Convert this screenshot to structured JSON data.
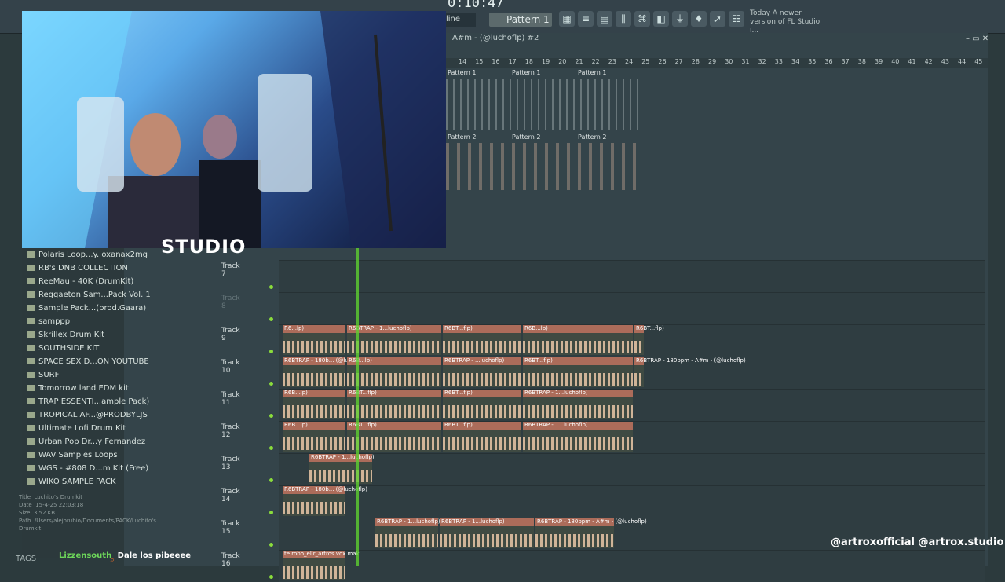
{
  "toolbar": {
    "time": "0:10:47",
    "mode": "line",
    "pattern": "Pattern 1",
    "news_label": "Today",
    "news_text": "A newer version of FL Studio i..."
  },
  "playlist": {
    "title": "A#m - (@luchoflp) #2",
    "ruler_numbers": [
      "14",
      "15",
      "16",
      "17",
      "18",
      "19",
      "20",
      "21",
      "22",
      "23",
      "24",
      "25",
      "26",
      "27",
      "28",
      "29",
      "30",
      "31",
      "32",
      "33",
      "34",
      "35",
      "36",
      "37",
      "38",
      "39",
      "40",
      "41",
      "42",
      "43",
      "44",
      "45"
    ],
    "pattern_labels": [
      "Pattern 1",
      "Pattern 1",
      "Pattern 1",
      "Pattern 2",
      "Pattern 2",
      "Pattern 2"
    ],
    "tracks": [
      {
        "label": "Track 7"
      },
      {
        "label": "Track 8"
      },
      {
        "label": "Track 9",
        "clips": [
          "R6...lp)",
          "R6BTRAP - 1...luchoflp)",
          "R6BT...flp)",
          "R6B...lp)",
          "R6BT...flp)"
        ]
      },
      {
        "label": "Track 10",
        "clips": [
          "R6BTRAP - 180b... (@luchoflp)",
          "R6B...lp)",
          "R6BTRAP - ...luchoflp)",
          "R6BT...flp)",
          "R6BTRAP - 180bpm - A#m - (@luchoflp)"
        ]
      },
      {
        "label": "Track 11",
        "clips": [
          "R6B...lp)",
          "R6BT...flp)",
          "R6BT...flp)",
          "R6BTRAP - 1...luchoflp)"
        ]
      },
      {
        "label": "Track 12",
        "clips": [
          "R6B...lp)",
          "R6BT...flp)",
          "R6BT...flp)",
          "R6BTRAP - 1...luchoflp)"
        ]
      },
      {
        "label": "Track 13",
        "clips": [
          "R6BTRAP - 1...luchoflp)"
        ]
      },
      {
        "label": "Track 14",
        "clips": [
          "R6BTRAP - 180b... (@luchoflp)"
        ]
      },
      {
        "label": "Track 15",
        "clips": [
          "R6BTRAP - 1...luchoflp)",
          "R6BTRAP - 1...luchoflp)",
          "R6BTRAP - 180bpm - A#m - (@luchoflp)"
        ]
      },
      {
        "label": "Track 16",
        "clips": [
          "te robo_ellr_artros vox mak"
        ]
      }
    ]
  },
  "browser": {
    "items": [
      "Polaris Loop...y. oxanax2mg",
      "RB's DNB COLLECTION",
      "ReeMau - 40K (DrumKit)",
      "Reggaeton Sam...Pack Vol. 1",
      "Sample Pack...(prod.Gaara)",
      "samppp",
      "Skrillex Drum Kit",
      "SOUTHSIDE KIT",
      "SPACE SEX D...ON YOUTUBE",
      "SURF",
      "Tomorrow land EDM kit",
      "TRAP ESSENTI...ample Pack)",
      "TROPICAL AF...@PRODBYLJS",
      "Ultimate Lofi Drum Kit",
      "Urban Pop Dr...y Fernandez",
      "WAV Samples Loops",
      "WGS - #808 D...m Kit (Free)",
      "WIKO SAMPLE PACK"
    ],
    "info": {
      "title_label": "Title",
      "title": "Luchito's Drumkit",
      "date_label": "Date",
      "date": "15-4-25 22:03:18",
      "size_label": "Size",
      "size": "3.52 KB",
      "path_label": "Path",
      "path": "/Users/alejorubio/Documents/PACK/Luchito's Drumkit"
    },
    "tags": "TAGS"
  },
  "overlay": {
    "studio_logo": "STUDIO",
    "chat_user": "Lizzensouth",
    "chat_message": "Dale los pibeeee",
    "watermark": "@artroxofficial  @artrox.studio"
  },
  "colors": {
    "accent": "#8adc3c",
    "clip": "#ac6c5a",
    "wave": "#e9c7a7"
  }
}
